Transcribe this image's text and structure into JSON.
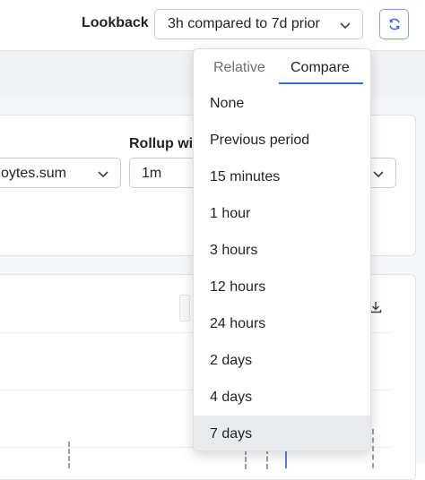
{
  "toolbar": {
    "lookback_label": "Lookback",
    "lookback_value": "3h compared to 7d prior"
  },
  "query": {
    "metric_value": "oytes.sum",
    "rollup_label": "Rollup wi",
    "rollup_value": "1m"
  },
  "popup": {
    "tabs": [
      "Relative",
      "Compare"
    ],
    "active_tab": "Compare",
    "options": [
      "None",
      "Previous period",
      "15 minutes",
      "1 hour",
      "3 hours",
      "12 hours",
      "24 hours",
      "2 days",
      "4 days",
      "7 days"
    ],
    "selected_option": "7 days"
  },
  "colors": {
    "accent": "#2f6fd6",
    "selected_bg": "#e9eaec"
  },
  "icons": {
    "refresh": "refresh-icon",
    "chevron": "chevron-down-icon",
    "download": "download-icon"
  }
}
